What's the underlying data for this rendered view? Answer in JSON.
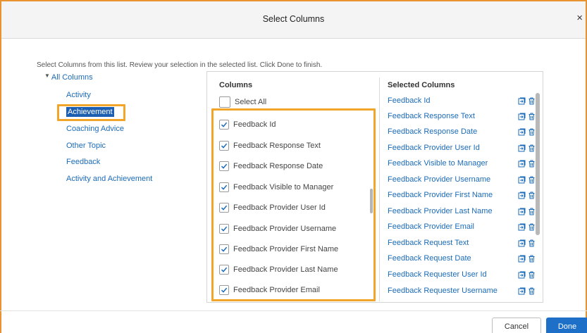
{
  "dialog": {
    "title": "Select Columns",
    "close": "×"
  },
  "instructions": "Select Columns from this list. Review your selection in the selected list. Click Done to finish.",
  "tree": {
    "root": "All Columns",
    "items": [
      "Activity",
      "Achievement",
      "Coaching Advice",
      "Other Topic",
      "Feedback",
      "Activity and Achievement"
    ],
    "selected_index": 1
  },
  "columns": {
    "header": "Columns",
    "select_all": "Select All",
    "items": [
      "Feedback Id",
      "Feedback Response Text",
      "Feedback Response Date",
      "Feedback Visible to Manager",
      "Feedback Provider User Id",
      "Feedback Provider Username",
      "Feedback Provider First Name",
      "Feedback Provider Last Name",
      "Feedback Provider Email"
    ]
  },
  "selected": {
    "header": "Selected Columns",
    "items": [
      "Feedback Id",
      "Feedback Response Text",
      "Feedback Response Date",
      "Feedback Provider User Id",
      "Feedback Visible to Manager",
      "Feedback Provider Username",
      "Feedback Provider First Name",
      "Feedback Provider Last Name",
      "Feedback Provider Email",
      "Feedback Request Text",
      "Feedback Request Date",
      "Feedback Requester User Id",
      "Feedback Requester Username"
    ]
  },
  "footer": {
    "cancel": "Cancel",
    "done": "Done"
  },
  "colors": {
    "accent": "#1e6fc7",
    "highlight": "#f1a62b",
    "link": "#1b6bb8",
    "dialog_border": "#e8932f"
  }
}
